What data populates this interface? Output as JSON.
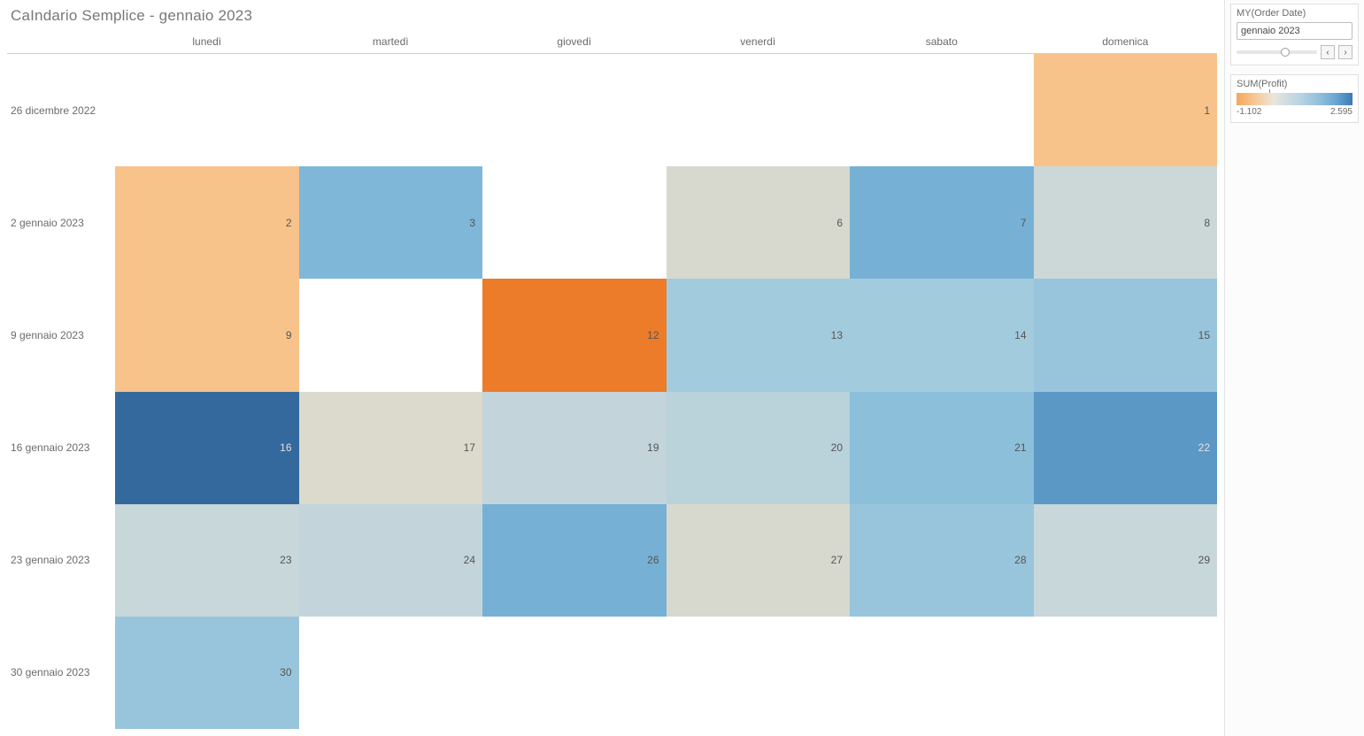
{
  "title": "CaIndario Semplice - gennaio 2023",
  "columns": [
    "lunedì",
    "martedì",
    "giovedì",
    "venerdì",
    "sabato",
    "domenica"
  ],
  "rows": [
    "26 dicembre 2022",
    "2 gennaio 2023",
    "9 gennaio 2023",
    "16 gennaio 2023",
    "23 gennaio 2023",
    "30 gennaio 2023"
  ],
  "filter": {
    "title": "MY(Order Date)",
    "value": "gennaio 2023"
  },
  "legend": {
    "title": "SUM(Profit)",
    "min": "-1.102",
    "max": "2.595"
  },
  "chart_data": {
    "type": "heatmap",
    "title": "CaIndario Semplice - gennaio 2023",
    "xlabel": "",
    "ylabel": "",
    "x_categories": [
      "lunedì",
      "martedì",
      "giovedì",
      "venerdì",
      "sabato",
      "domenica"
    ],
    "y_categories": [
      "26 dicembre 2022",
      "2 gennaio 2023",
      "9 gennaio 2023",
      "16 gennaio 2023",
      "23 gennaio 2023",
      "30 gennaio 2023"
    ],
    "color_scale": {
      "min": -1102,
      "max": 2595
    },
    "legend_title": "SUM(Profit)",
    "cells": [
      [
        {
          "day": null,
          "profit": null
        },
        {
          "day": null,
          "profit": null
        },
        {
          "day": null,
          "profit": null
        },
        {
          "day": null,
          "profit": null
        },
        {
          "day": null,
          "profit": null
        },
        {
          "day": 1,
          "profit": -400,
          "color": "#f7c38b"
        }
      ],
      [
        {
          "day": 2,
          "profit": -400,
          "color": "#f7c38b"
        },
        {
          "day": 3,
          "profit": 1000,
          "color": "#7fb7d8"
        },
        {
          "day": null,
          "profit": null
        },
        {
          "day": 6,
          "profit": 300,
          "color": "#d7d9cf"
        },
        {
          "day": 7,
          "profit": 1100,
          "color": "#76b1d5"
        },
        {
          "day": 8,
          "profit": 400,
          "color": "#ccd8d8"
        }
      ],
      [
        {
          "day": 9,
          "profit": -400,
          "color": "#f7c38b"
        },
        {
          "day": null,
          "profit": null
        },
        {
          "day": 12,
          "profit": -1102,
          "color": "#ec7c29"
        },
        {
          "day": 13,
          "profit": 700,
          "color": "#a3cbde"
        },
        {
          "day": 14,
          "profit": 700,
          "color": "#a3cbde"
        },
        {
          "day": 15,
          "profit": 800,
          "color": "#98c5db"
        }
      ],
      [
        {
          "day": 16,
          "profit": 2595,
          "color": "#34699e"
        },
        {
          "day": 17,
          "profit": 250,
          "color": "#dbdacd"
        },
        {
          "day": 19,
          "profit": 500,
          "color": "#c3d5da"
        },
        {
          "day": 20,
          "profit": 550,
          "color": "#bad2da"
        },
        {
          "day": 21,
          "profit": 900,
          "color": "#8cbfd9"
        },
        {
          "day": 22,
          "profit": 1600,
          "color": "#5b98c6"
        }
      ],
      [
        {
          "day": 23,
          "profit": 450,
          "color": "#c8d7d9"
        },
        {
          "day": 24,
          "profit": 500,
          "color": "#c3d5da"
        },
        {
          "day": 26,
          "profit": 1100,
          "color": "#76b1d5"
        },
        {
          "day": 27,
          "profit": 300,
          "color": "#d7d9cf"
        },
        {
          "day": 28,
          "profit": 800,
          "color": "#98c5db"
        },
        {
          "day": 29,
          "profit": 450,
          "color": "#c8d7d9"
        }
      ],
      [
        {
          "day": 30,
          "profit": 800,
          "color": "#98c5db"
        },
        {
          "day": null,
          "profit": null
        },
        {
          "day": null,
          "profit": null
        },
        {
          "day": null,
          "profit": null
        },
        {
          "day": null,
          "profit": null
        },
        {
          "day": null,
          "profit": null
        }
      ]
    ]
  }
}
